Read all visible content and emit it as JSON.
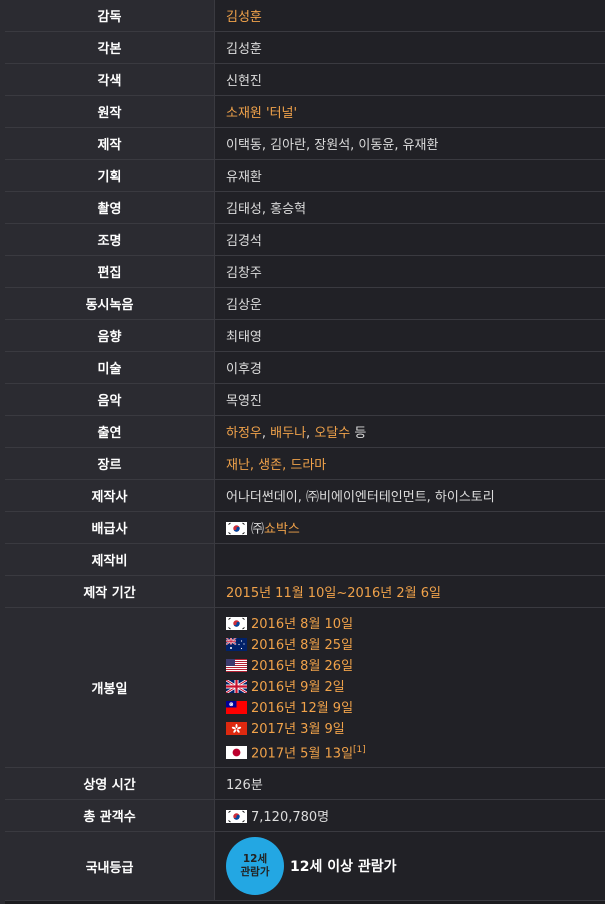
{
  "rows": [
    {
      "label": "감독",
      "value": "김성훈",
      "link": true
    },
    {
      "label": "각본",
      "value": "김성훈",
      "link": false
    },
    {
      "label": "각색",
      "value": "신현진",
      "link": false
    },
    {
      "label": "원작",
      "value": "소재원 '터널'",
      "link": true
    },
    {
      "label": "제작",
      "value": "이택동, 김아란, 장원석, 이동윤, 유재환",
      "link": false
    },
    {
      "label": "기획",
      "value": "유재환",
      "link": false
    },
    {
      "label": "촬영",
      "value": "김태성, 홍승혁",
      "link": false
    },
    {
      "label": "조명",
      "value": "김경석",
      "link": false
    },
    {
      "label": "편집",
      "value": "김창주",
      "link": false
    },
    {
      "label": "동시녹음",
      "value": "김상운",
      "link": false
    },
    {
      "label": "음향",
      "value": "최태영",
      "link": false
    },
    {
      "label": "미술",
      "value": "이후경",
      "link": false
    },
    {
      "label": "음악",
      "value": "목영진",
      "link": false
    }
  ],
  "cast": {
    "label": "출연",
    "names": [
      "하정우",
      "배두나",
      "오달수"
    ],
    "suffix": " 등"
  },
  "genre": {
    "label": "장르",
    "value": "재난, 생존, 드라마"
  },
  "producer_company": {
    "label": "제작사",
    "value": "어나더썬데이, ㈜비에이엔터테인먼트, 하이스토리"
  },
  "distributor": {
    "label": "배급사",
    "prefix": "㈜",
    "value": "쇼박스"
  },
  "budget": {
    "label": "제작비",
    "value": ""
  },
  "production_period": {
    "label": "제작 기간",
    "value": "2015년 11월 10일~2016년 2월 6일"
  },
  "release": {
    "label": "개봉일",
    "dates": [
      {
        "flag": "south-korea-flag",
        "date": "2016년 8월 10일"
      },
      {
        "flag": "australia-flag",
        "date": "2016년 8월 25일"
      },
      {
        "flag": "usa-flag",
        "date": "2016년 8월 26일"
      },
      {
        "flag": "uk-flag",
        "date": "2016년 9월 2일"
      },
      {
        "flag": "taiwan-flag",
        "date": "2016년 12월 9일"
      },
      {
        "flag": "hong-kong-flag",
        "date": "2017년 3월 9일"
      },
      {
        "flag": "japan-flag",
        "date": "2017년 5월 13일"
      }
    ],
    "footnote": "[1]"
  },
  "runtime": {
    "label": "상영 시간",
    "value": "126분"
  },
  "audience": {
    "label": "총 관객수",
    "value": "7,120,780명"
  },
  "rating": {
    "label": "국내등급",
    "badge_line1": "12세",
    "badge_line2": "관람가",
    "text": "12세 이상 관람가"
  },
  "colors": {
    "link": "#f0a24a",
    "label_bg": "#2b2b31",
    "value_bg": "#212126",
    "badge": "#23a7e3"
  }
}
